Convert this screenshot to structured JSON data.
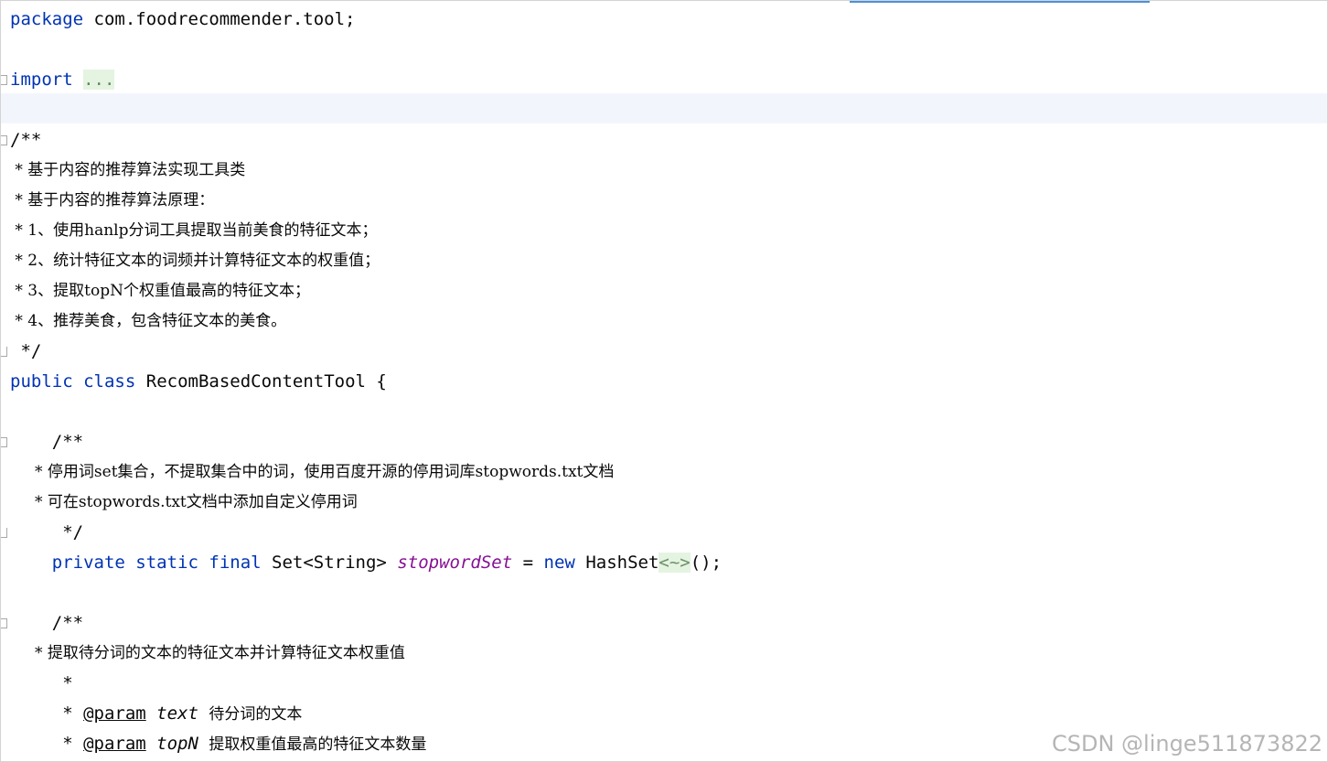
{
  "editor": {
    "package": {
      "keyword": "package",
      "name": " com.foodrecommender.tool;"
    },
    "import": {
      "keyword": "import",
      "folded": "..."
    },
    "class_doc": [
      "/**",
      " * 基于内容的推荐算法实现工具类",
      " * 基于内容的推荐算法原理：",
      " * 1、使用hanlp分词工具提取当前美食的特征文本；",
      " * 2、统计特征文本的词频并计算特征文本的权重值；",
      " * 3、提取topN个权重值最高的特征文本；",
      " * 4、推荐美食，包含特征文本的美食。",
      " */"
    ],
    "class_decl": {
      "kw_public": "public",
      "kw_class": "class",
      "name": "RecomBasedContentTool",
      "brace": "{"
    },
    "field_doc": [
      "    /**",
      "     * 停用词set集合，不提取集合中的词，使用百度开源的停用词库stopwords.txt文档",
      "     * 可在stopwords.txt文档中添加自定义停用词",
      "     */"
    ],
    "field_decl": {
      "kw_private": "private",
      "kw_static": "static",
      "kw_final": "final",
      "type": "Set<String>",
      "name": "stopwordSet",
      "assign": "=",
      "kw_new": "new",
      "ctor": "HashSet",
      "diamond": "<~>",
      "tail": "();"
    },
    "method_doc": {
      "open": "    /**",
      "desc": "     * 提取待分词的文本的特征文本并计算特征文本权重值",
      "blank": "     *",
      "param1": {
        "prefix": "     * ",
        "tag": "@param",
        "name": "text",
        "desc": "待分词的文本"
      },
      "param2": {
        "prefix": "     * ",
        "tag": "@param",
        "name": "topN",
        "desc": "提取权重值最高的特征文本数量"
      }
    }
  },
  "watermark": "CSDN @linge511873822"
}
